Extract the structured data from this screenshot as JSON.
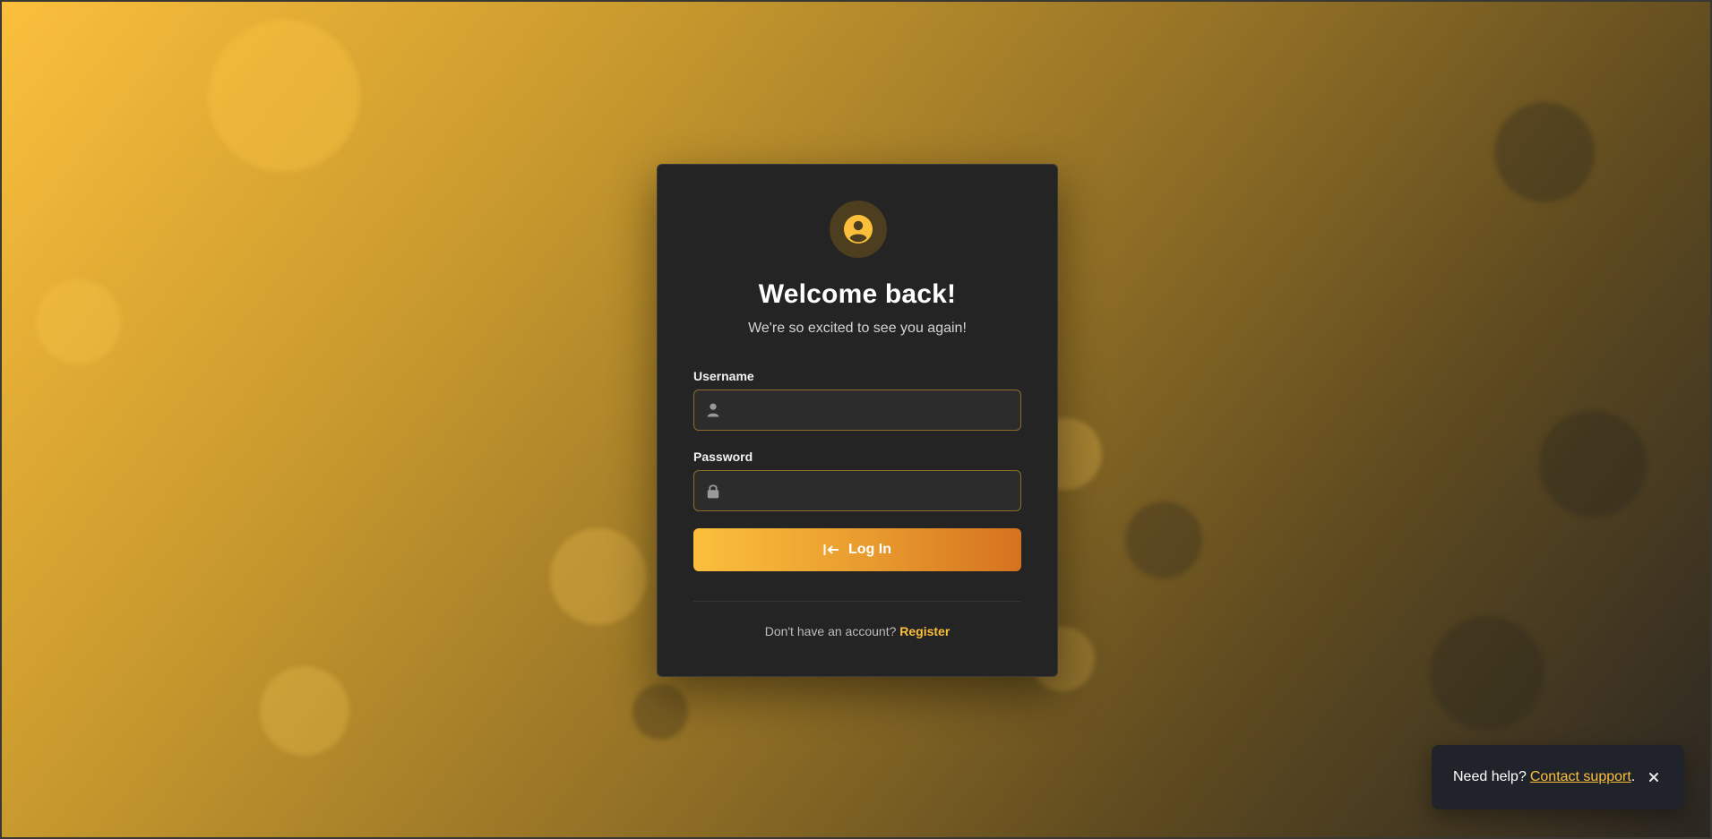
{
  "login": {
    "title": "Welcome back!",
    "subtitle": "We're so excited to see you again!",
    "username_label": "Username",
    "username_value": "",
    "password_label": "Password",
    "password_value": "",
    "button_label": "Log In",
    "footer_text": "Don't have an account?",
    "register_link": "Register"
  },
  "help": {
    "text": "Need help?",
    "link": "Contact support",
    "suffix": "."
  },
  "icons": {
    "avatar": "user-circle-icon",
    "username": "user-icon",
    "password": "lock-icon",
    "login": "sign-in-icon",
    "close": "close-icon"
  },
  "colors": {
    "accent": "#fbbf3c",
    "accent_dark": "#d5721f",
    "card_bg": "#242424",
    "field_border": "#8a6d2a",
    "toast_bg": "#20242a"
  }
}
